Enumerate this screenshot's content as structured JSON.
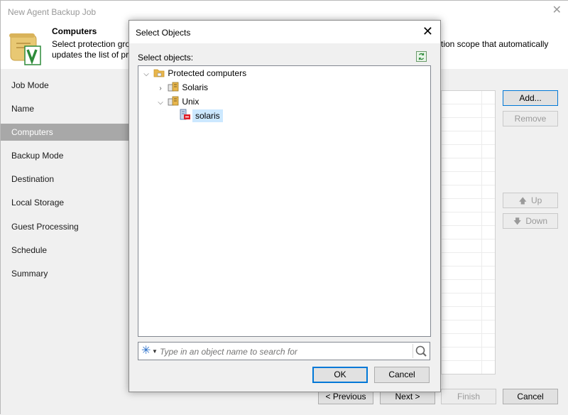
{
  "window": {
    "title": "New Agent Backup Job"
  },
  "header": {
    "title": "Computers",
    "desc_left": "Select protection gro\nupdates the list of pr",
    "desc_right": "tion scope that automatically"
  },
  "steps": [
    {
      "label": "Job Mode",
      "active": false
    },
    {
      "label": "Name",
      "active": false
    },
    {
      "label": "Computers",
      "active": true
    },
    {
      "label": "Backup Mode",
      "active": false
    },
    {
      "label": "Destination",
      "active": false
    },
    {
      "label": "Local Storage",
      "active": false
    },
    {
      "label": "Guest Processing",
      "active": false
    },
    {
      "label": "Schedule",
      "active": false
    },
    {
      "label": "Summary",
      "active": false
    }
  ],
  "side_buttons": {
    "add": "Add...",
    "remove": "Remove",
    "up": "Up",
    "down": "Down"
  },
  "footer": {
    "previous": "< Previous",
    "next": "Next >",
    "finish": "Finish",
    "cancel": "Cancel"
  },
  "dialog": {
    "title": "Select Objects",
    "label": "Select objects:",
    "tree": [
      {
        "label": "Protected computers",
        "icon": "folder-icon",
        "expanded": true
      },
      {
        "label": "Solaris",
        "icon": "server-group-icon",
        "expanded": false
      },
      {
        "label": "Unix",
        "icon": "server-group-icon",
        "expanded": true
      },
      {
        "label": "solaris",
        "icon": "computer-error-icon",
        "selected": true
      }
    ],
    "search_placeholder": "Type in an object name to search for",
    "ok": "OK",
    "cancel": "Cancel"
  },
  "colors": {
    "selection": "#cce8ff",
    "active_step": "#a8a8a8",
    "accent": "#0078d7",
    "error": "#e0202a",
    "folder": "#e8b64c"
  }
}
